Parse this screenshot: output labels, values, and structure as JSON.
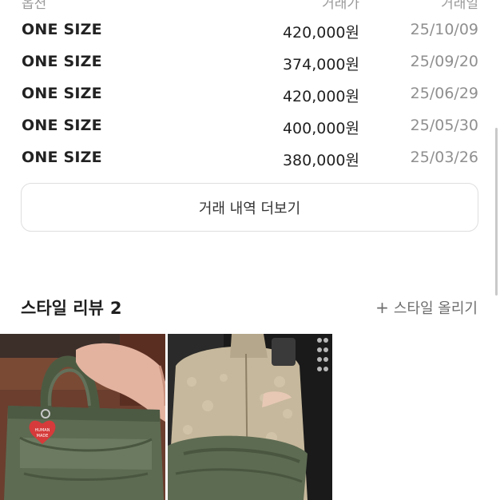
{
  "header": {
    "col_option": "옵션",
    "col_price": "거래가",
    "col_date": "거래일"
  },
  "trades": [
    {
      "size": "ONE SIZE",
      "price": "420,000원",
      "date": "25/10/09"
    },
    {
      "size": "ONE SIZE",
      "price": "374,000원",
      "date": "25/09/20"
    },
    {
      "size": "ONE SIZE",
      "price": "420,000원",
      "date": "25/06/29"
    },
    {
      "size": "ONE SIZE",
      "price": "400,000원",
      "date": "25/05/30"
    },
    {
      "size": "ONE SIZE",
      "price": "380,000원",
      "date": "25/03/26"
    }
  ],
  "more_button": {
    "label": "거래 내역 더보기"
  },
  "reviews": {
    "title": "스타일 리뷰",
    "count": "2",
    "upload_label": "스타일 올리기",
    "upload_icon": "plus-icon"
  },
  "photos": [
    {
      "logo_line1": "HUMAN",
      "logo_line2": "MADE"
    },
    {}
  ],
  "colors": {
    "text_primary": "#222222",
    "text_muted": "#8f8f8f",
    "border": "#dedede",
    "bag_green": "#5d6b52"
  }
}
